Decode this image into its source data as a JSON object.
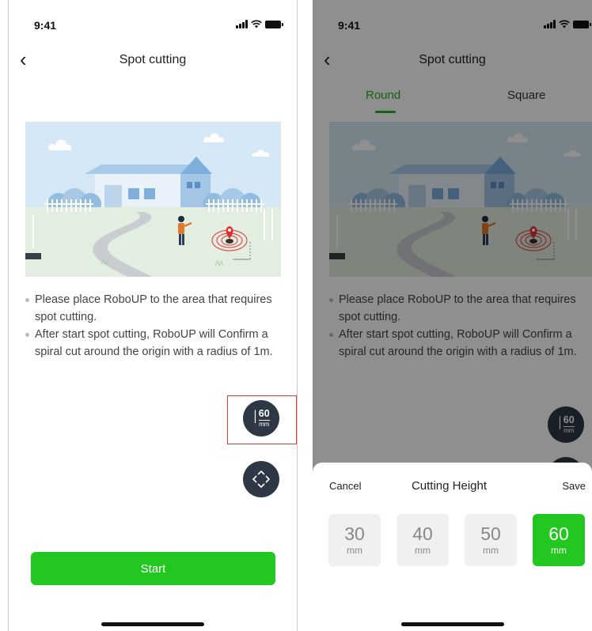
{
  "left": {
    "status": {
      "time": "9:41"
    },
    "nav": {
      "back": "‹",
      "title": "Spot cutting"
    },
    "tips": [
      "Please place RoboUP to the area that requires spot cutting.",
      "After start spot cutting, RoboUP will Confirm a spiral cut around the origin with a radius of 1m."
    ],
    "height_fab": {
      "value": "60",
      "unit": "mm"
    },
    "start_label": "Start"
  },
  "right": {
    "status": {
      "time": "9:41"
    },
    "nav": {
      "back": "‹",
      "title": "Spot cutting"
    },
    "tabs": [
      {
        "label": "Round",
        "active": true
      },
      {
        "label": "Square",
        "active": false
      }
    ],
    "tips": [
      "Please place RoboUP to the area that requires spot cutting.",
      "After start spot cutting, RoboUP will Confirm a spiral cut around the origin with a radius of 1m."
    ],
    "height_fab": {
      "value": "60",
      "unit": "mm"
    },
    "sheet": {
      "cancel": "Cancel",
      "title": "Cutting Height",
      "save": "Save",
      "options": [
        {
          "value": "30",
          "unit": "mm",
          "selected": false
        },
        {
          "value": "40",
          "unit": "mm",
          "selected": false
        },
        {
          "value": "50",
          "unit": "mm",
          "selected": false
        },
        {
          "value": "60",
          "unit": "mm",
          "selected": true
        }
      ]
    }
  },
  "colors": {
    "accent_green": "#22c71f",
    "tab_green": "#22b020",
    "fab_dark": "#2e3844",
    "highlight_red": "#e53935",
    "sky": "#d6e8f5",
    "house_blue": "#8fb8e0"
  }
}
